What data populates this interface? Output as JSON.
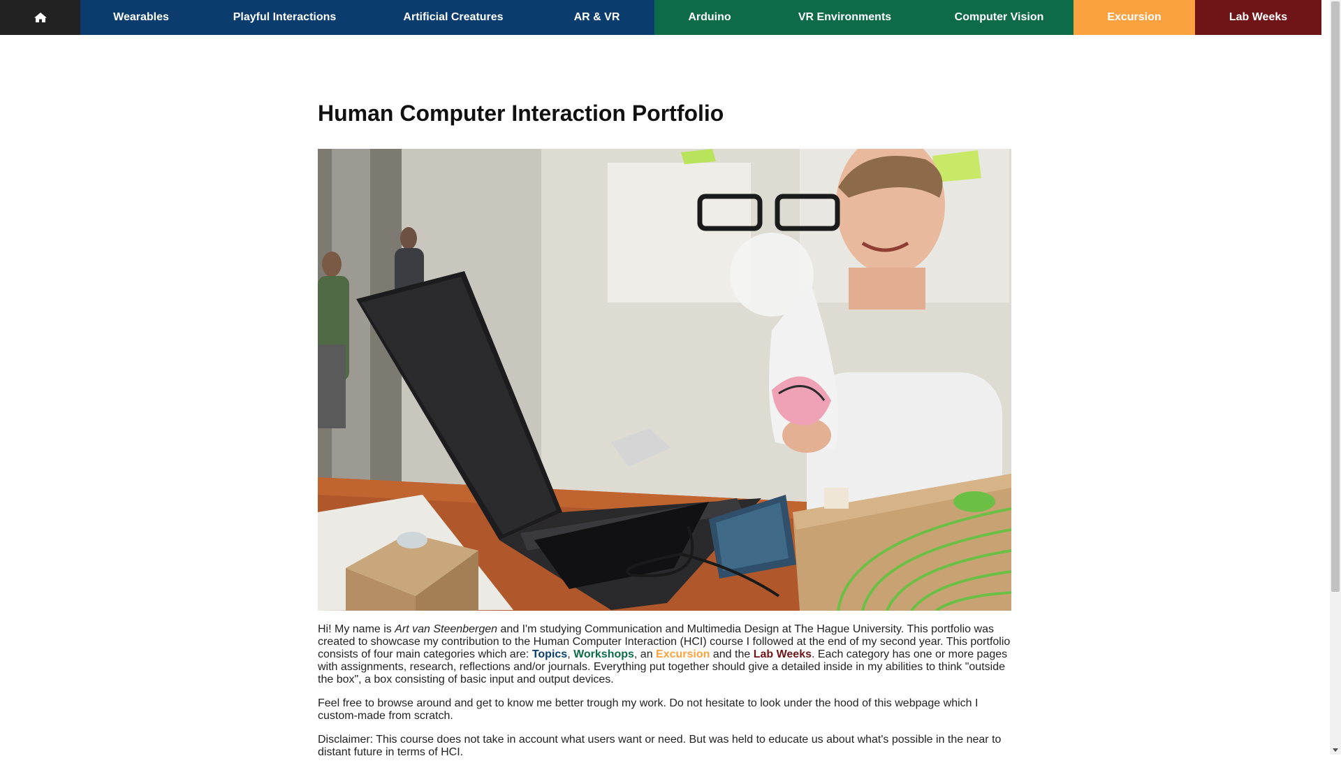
{
  "nav": {
    "home_icon": "home-icon",
    "items": [
      {
        "label": "Wearables",
        "group": "topics"
      },
      {
        "label": "Playful Interactions",
        "group": "topics"
      },
      {
        "label": "Artificial Creatures",
        "group": "topics"
      },
      {
        "label": "AR & VR",
        "group": "topics"
      },
      {
        "label": "Arduino",
        "group": "workshops"
      },
      {
        "label": "VR Environments",
        "group": "workshops"
      },
      {
        "label": "Computer Vision",
        "group": "workshops"
      },
      {
        "label": "Excursion",
        "group": "excursion"
      },
      {
        "label": "Lab Weeks",
        "group": "labweeks"
      }
    ]
  },
  "colors": {
    "topics": "#0a3d6e",
    "workshops": "#0e6b48",
    "excursion": "#f9a23f",
    "labweeks": "#6f1518",
    "home": "#222222"
  },
  "page": {
    "title": "Human Computer Interaction Portfolio",
    "intro": {
      "p1_a": "Hi! My name is ",
      "name": "Art van Steenbergen",
      "p1_b": " and I'm studying Communication and Multimedia Design at The Hague University. This portfolio was created to showcase my contribution to the Human Computer Interaction (HCI) course I followed at the end of my second year. This portfolio consists of four main categories which are: ",
      "link_topics": "Topics",
      "sep1": ", ",
      "link_workshops": "Workshops",
      "sep2": ", an ",
      "link_excursion": "Excursion",
      "sep3": " and the ",
      "link_labweeks": "Lab Weeks",
      "p1_c": ". Each category has one or more pages with assignments, research, reflections and/or journals. Everything put together should give a detailed inside in my abilities to think \"outside the box\", a box consisting of basic input and output devices.",
      "p2": "Feel free to browse around and get to know me better trough my work. Do not hesitate to look under the hood of this webpage which I custom-made from scratch.",
      "p3": "Disclaimer: This course does not take in account what users want or need. But was held to educate us about what's possible in the near to distant future in terms of HCI."
    }
  }
}
